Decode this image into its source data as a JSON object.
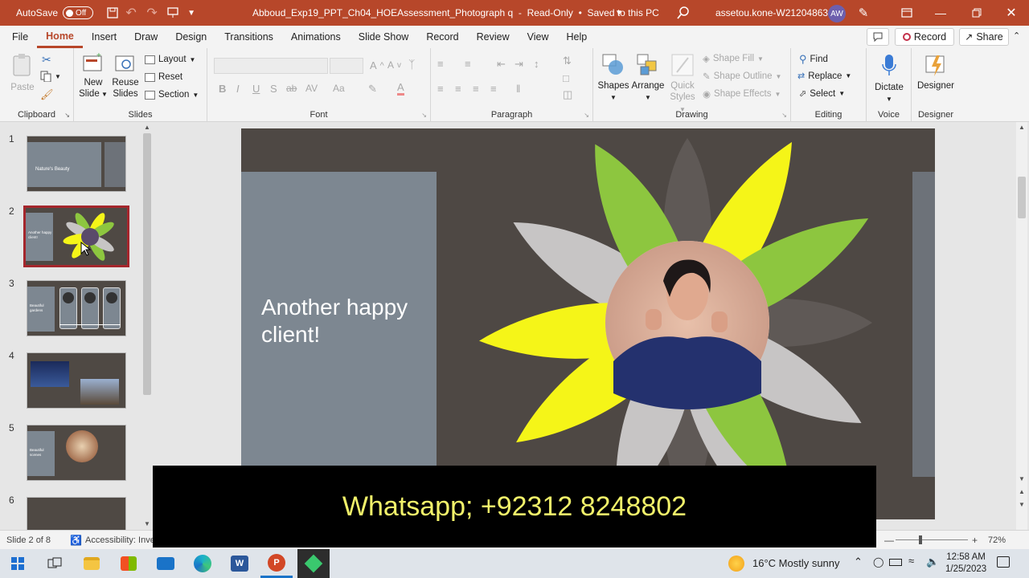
{
  "titlebar": {
    "autosave_label": "AutoSave",
    "autosave_state": "Off",
    "doc_title": "Abboud_Exp19_PPT_Ch04_HOEAssessment_Photograph q",
    "doc_status": "Read-Only",
    "save_status": "Saved to this PC",
    "user": "assetou.kone-W212048638",
    "initials": "AW"
  },
  "menu": {
    "tabs": [
      "File",
      "Home",
      "Insert",
      "Draw",
      "Design",
      "Transitions",
      "Animations",
      "Slide Show",
      "Record",
      "Review",
      "View",
      "Help"
    ],
    "comments_icon": "comment-icon",
    "record_label": "Record",
    "share_label": "Share"
  },
  "ribbon": {
    "clipboard": {
      "label": "Clipboard",
      "paste": "Paste"
    },
    "slides": {
      "label": "Slides",
      "new_slide_1": "New",
      "new_slide_2": "Slide",
      "reuse_1": "Reuse",
      "reuse_2": "Slides",
      "layout": "Layout",
      "reset": "Reset",
      "section": "Section"
    },
    "font": {
      "label": "Font"
    },
    "paragraph": {
      "label": "Paragraph"
    },
    "drawing": {
      "label": "Drawing",
      "shapes": "Shapes",
      "arrange": "Arrange",
      "quick_1": "Quick",
      "quick_2": "Styles",
      "fill": "Shape Fill",
      "outline": "Shape Outline",
      "effects": "Shape Effects"
    },
    "editing": {
      "label": "Editing",
      "find": "Find",
      "replace": "Replace",
      "select": "Select"
    },
    "voice": {
      "label": "Voice",
      "dictate": "Dictate"
    },
    "designer": {
      "label": "Designer",
      "designer": "Designer"
    }
  },
  "slides_panel": {
    "numbers": [
      "1",
      "2",
      "3",
      "4",
      "5",
      "6"
    ],
    "thumb1_title": "Nature's Beauty",
    "thumb2_title": "Another happy client!",
    "thumb3_title": "Beautiful gardens",
    "thumb5_title": "Beautiful scenes"
  },
  "slide": {
    "title": "Another happy client!"
  },
  "caption": {
    "text": "Whatsapp; +92312 8248802"
  },
  "status": {
    "slide_info": "Slide 2 of 8",
    "accessibility": "Accessibility: Inve",
    "zoom": "72%"
  },
  "taskbar": {
    "weather": "16°C  Mostly sunny",
    "time": "12:58 AM",
    "date": "1/25/2023"
  },
  "colors": {
    "accent": "#b7472a",
    "petal_green": "#8dc63f",
    "petal_yellow": "#f5f518",
    "petal_gray": "#c7c5c5",
    "petal_dark": "#5f5956",
    "slide_bg": "#4e4844",
    "caption_text": "#f2f26a"
  }
}
